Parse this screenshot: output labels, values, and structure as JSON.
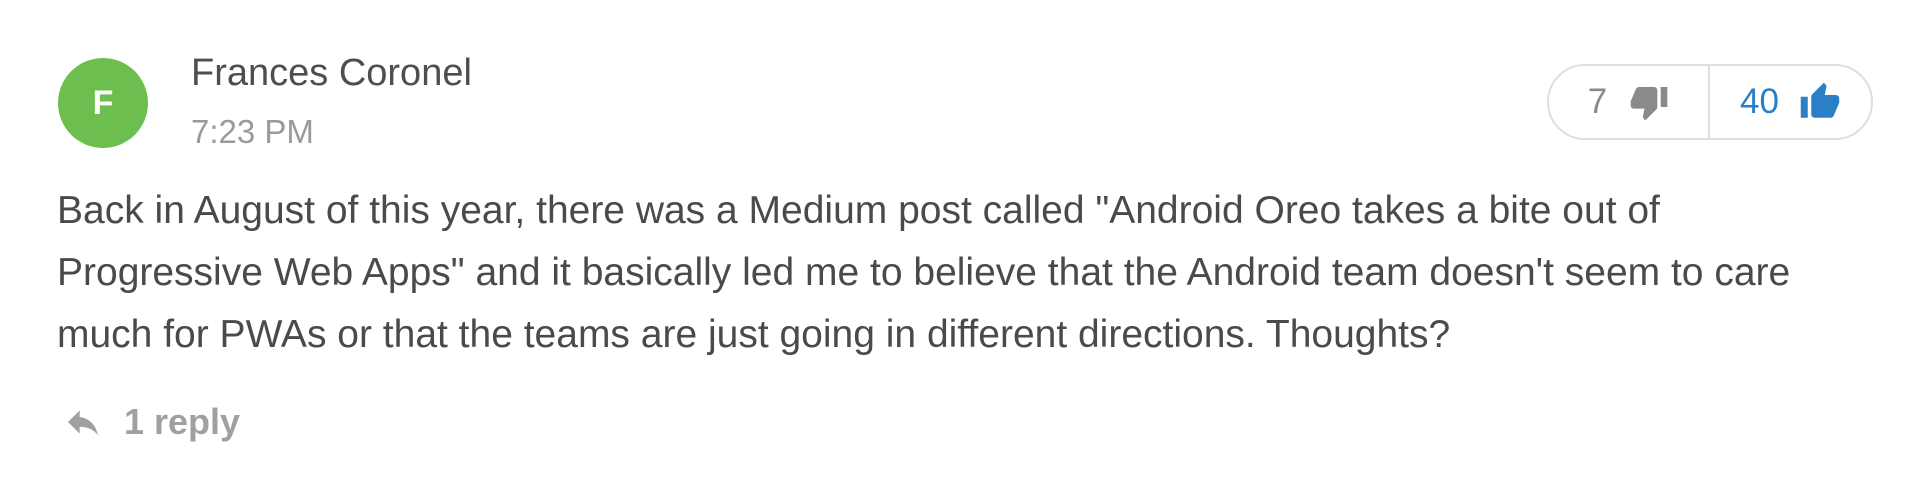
{
  "comment": {
    "author": {
      "initial": "F",
      "name": "Frances Coronel",
      "avatar_color": "#6cbf4f"
    },
    "timestamp": "7:23 PM",
    "votes": {
      "down_count": "7",
      "down_icon": "thumbs-down-icon",
      "up_count": "40",
      "up_icon": "thumbs-up-icon",
      "up_color": "#2a7fc6"
    },
    "body": "Back in August of this year, there was a Medium post called \"Android Oreo takes a bite out of Progressive Web Apps\" and it basically led me to believe that the Android team doesn't seem to care much for PWAs or that the teams are just going in different directions. Thoughts?",
    "reply": {
      "icon": "reply-icon",
      "label": "1 reply"
    }
  }
}
